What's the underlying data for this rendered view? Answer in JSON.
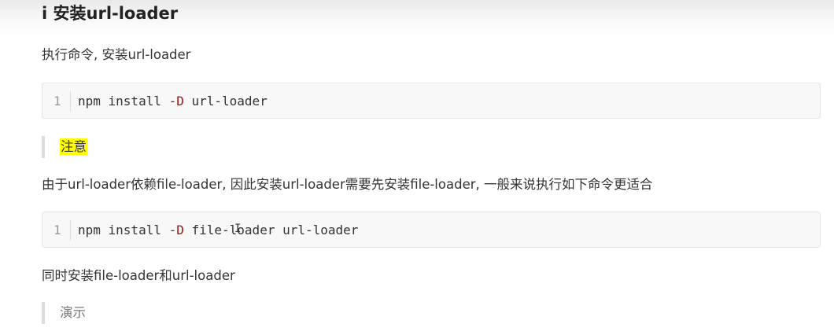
{
  "heading": "i 安装url-loader",
  "intro": "执行命令, 安装url-loader",
  "code_block_1": {
    "line_number": "1",
    "command": "npm install ",
    "flag": "-D",
    "args": " url-loader"
  },
  "note": {
    "label": "注意"
  },
  "dependency_text": "由于url-loader依赖file-loader, 因此安装url-loader需要先安装file-loader, 一般来说执行如下命令更适合",
  "code_block_2": {
    "line_number": "1",
    "command": "npm install ",
    "flag": "-D",
    "args": " file-loader url-loader"
  },
  "summary_text": "同时安装file-loader和url-loader",
  "demo": {
    "label": "演示"
  },
  "colors": {
    "highlight": "#ffff00",
    "flag": "#a31515",
    "code_bg": "#f8f8f8",
    "quote_border": "#dddddd"
  }
}
